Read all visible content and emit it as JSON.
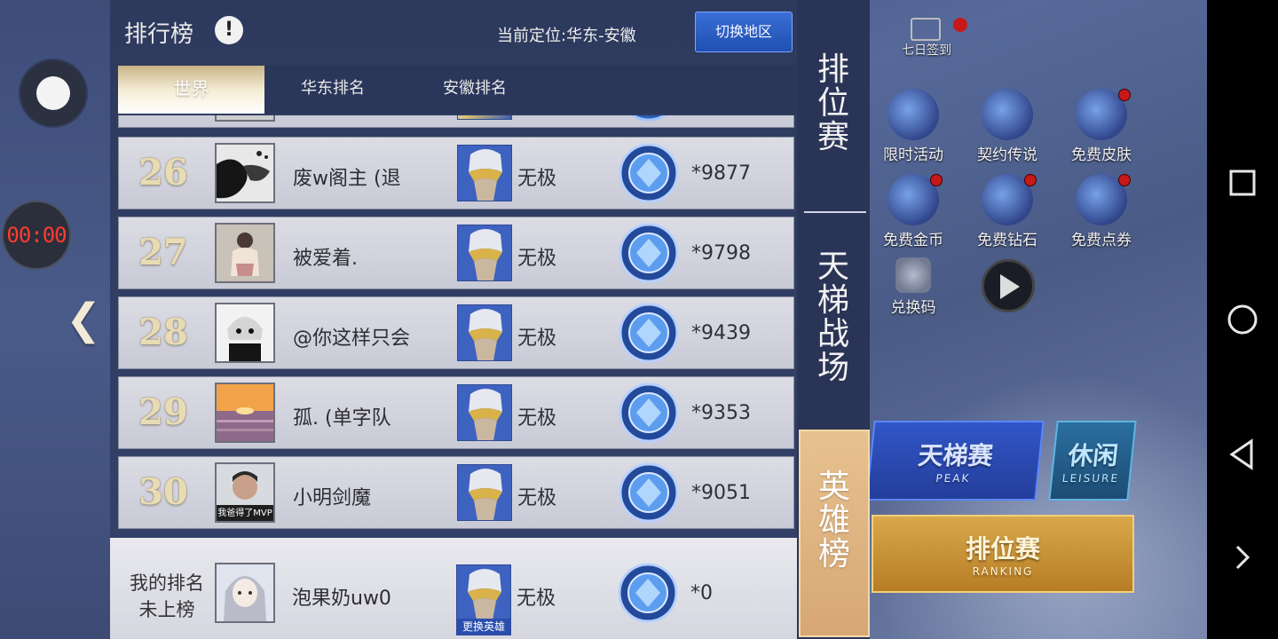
{
  "panel": {
    "title": "排行榜",
    "info_icon": "!",
    "location_label": "当前定位:",
    "location_value": "华东-安徽",
    "switch_region_label": "切换地区"
  },
  "tabs": [
    {
      "label": "世界",
      "active": true
    },
    {
      "label": "华东排名",
      "active": false
    },
    {
      "label": "安徽排名",
      "active": false
    }
  ],
  "rows": [
    {
      "rank": "26",
      "name": "废w阁主 (退",
      "hero": "无极",
      "score": "*9877",
      "avatar": "dark-scene"
    },
    {
      "rank": "27",
      "name": "被爱着.",
      "hero": "无极",
      "score": "*9798",
      "avatar": "sketch-girl"
    },
    {
      "rank": "28",
      "name": "@你这样只会",
      "hero": "无极",
      "score": "*9439",
      "avatar": "anime-bw"
    },
    {
      "rank": "29",
      "name": "孤. (单字队",
      "hero": "无极",
      "score": "*9353",
      "avatar": "sunset-sea"
    },
    {
      "rank": "30",
      "name": "小明剑魔",
      "hero": "无极",
      "score": "*9051",
      "avatar": "photo-man",
      "avatar_caption": "我爸得了MVP"
    }
  ],
  "my_rank": {
    "label_line1": "我的排名",
    "label_line2": "未上榜",
    "name": "泡果奶uw0",
    "hero": "无极",
    "change_hero_label": "更换英雄",
    "score": "*0"
  },
  "categories": [
    {
      "label": "排位赛",
      "chars": [
        "排",
        "位",
        "赛"
      ],
      "active": false
    },
    {
      "label": "天梯战场",
      "chars": [
        "天",
        "梯",
        "战",
        "场"
      ],
      "active": false
    },
    {
      "label": "英雄榜",
      "chars": [
        "英",
        "雄",
        "榜"
      ],
      "active": true
    }
  ],
  "overlay": {
    "timer": "00:00"
  },
  "background": {
    "top_feature": "七日签到",
    "features": [
      {
        "label": "限时活动",
        "red_dot": false
      },
      {
        "label": "契约传说",
        "red_dot": false
      },
      {
        "label": "免费皮肤",
        "red_dot": true
      },
      {
        "label": "免费金币",
        "red_dot": true
      },
      {
        "label": "免费钻石",
        "red_dot": true
      },
      {
        "label": "免费点券",
        "red_dot": true
      },
      {
        "label": "兑换码",
        "red_dot": false
      }
    ],
    "mode_tianti": {
      "title": "天梯赛",
      "sub": "PEAK"
    },
    "mode_xiuxian": {
      "title": "休闲",
      "sub": "LEISURE"
    },
    "mode_paiwei": {
      "title": "排位赛",
      "sub": "RANKING"
    }
  },
  "colors": {
    "panel_bg": "#2d3a5d",
    "row_bg": "#dcdce4",
    "rank_gold": "#e9dcb3",
    "switch_btn": "#2a5bc6",
    "active_category": "#e0b682",
    "timer_red": "#ff3b30"
  },
  "icons": {
    "badge": "blue-diamond-rank-badge-icon",
    "hero": "wuji-hero-portrait-icon",
    "collapse": "double-chevron-left-icon",
    "nav": [
      "square-recents-icon",
      "circle-home-icon",
      "triangle-back-icon",
      "chevron-right-icon"
    ]
  }
}
